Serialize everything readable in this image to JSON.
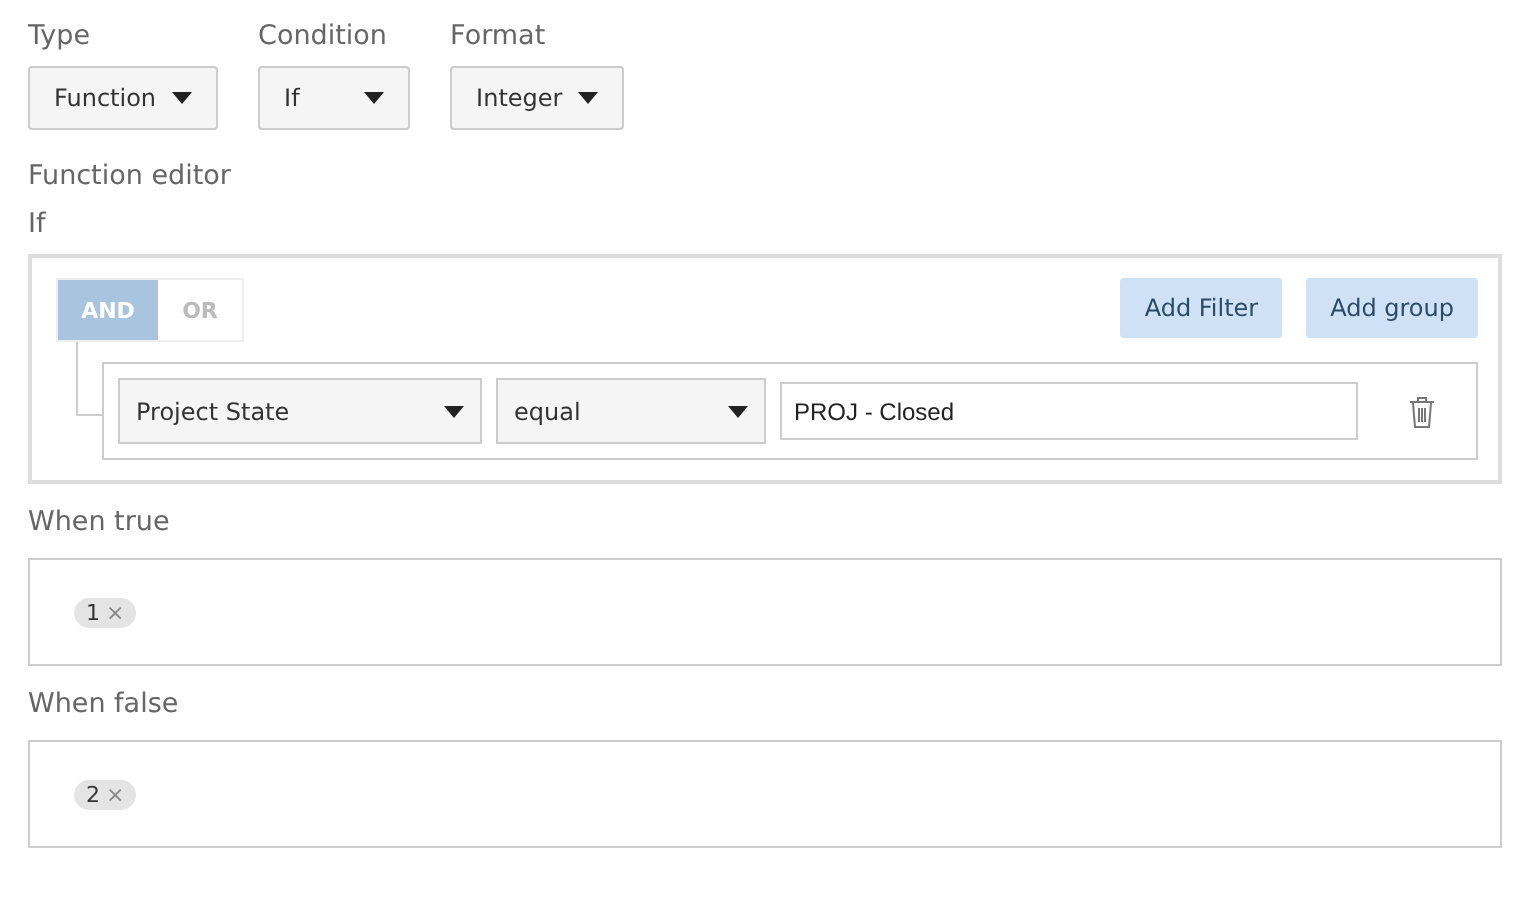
{
  "selectors": [
    {
      "label": "Type",
      "value": "Function"
    },
    {
      "label": "Condition",
      "value": "If"
    },
    {
      "label": "Format",
      "value": "Integer"
    }
  ],
  "editor_label": "Function editor",
  "condition_label": "If",
  "query": {
    "conjunctions": [
      {
        "label": "AND",
        "selected": true
      },
      {
        "label": "OR",
        "selected": false
      }
    ],
    "buttons": [
      "Add Filter",
      "Add group"
    ],
    "rules": [
      {
        "field": "Project State",
        "operator": "equal",
        "value": "PROJ - Closed"
      }
    ]
  },
  "branches": [
    {
      "label": "When true",
      "tags": [
        {
          "text": "1",
          "remove": "×"
        }
      ]
    },
    {
      "label": "When false",
      "tags": [
        {
          "text": "2",
          "remove": "×"
        }
      ]
    }
  ]
}
